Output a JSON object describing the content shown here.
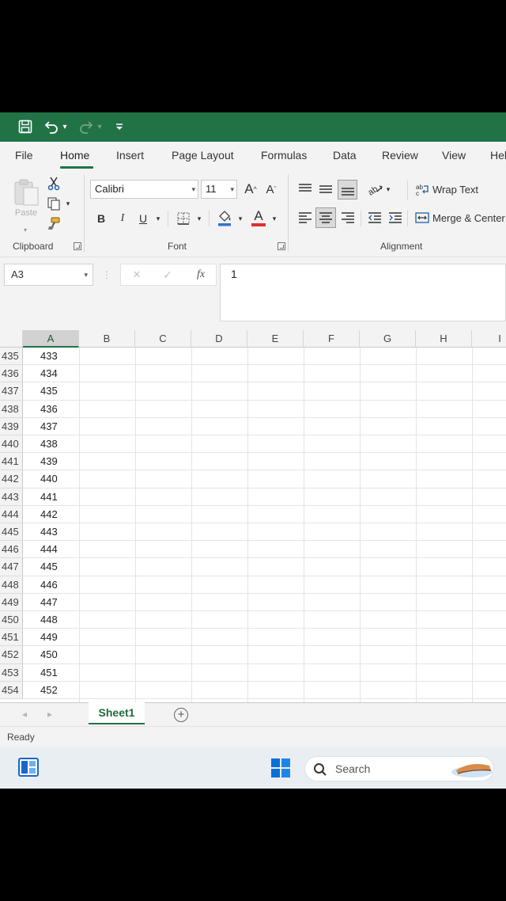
{
  "colors": {
    "excel_green": "#217346",
    "taskbar": "#e9eef3",
    "win_blue": "#0a6fd6"
  },
  "qat": {
    "icons": [
      "save-icon",
      "undo-icon",
      "redo-icon",
      "customize-icon"
    ],
    "dropdown_glyph": "▾"
  },
  "tabs": [
    "File",
    "Home",
    "Insert",
    "Page Layout",
    "Formulas",
    "Data",
    "Review",
    "View",
    "Hel"
  ],
  "ribbon": {
    "clipboard": {
      "label": "Clipboard",
      "paste_label": "Paste"
    },
    "font": {
      "label": "Font",
      "font_name": "Calibri",
      "font_size": "11",
      "bold": "B",
      "italic": "I",
      "underline": "U",
      "increase_font": "A",
      "decrease_font": "A",
      "font_color": "A"
    },
    "alignment": {
      "label": "Alignment",
      "wrap_text": "Wrap Text",
      "merge_center": "Merge & Center"
    }
  },
  "formula_bar": {
    "name_box": "A3",
    "cancel_glyph": "✕",
    "enter_glyph": "✓",
    "fx_glyph": "fx",
    "value": "1"
  },
  "grid": {
    "columns": [
      "A",
      "B",
      "C",
      "D",
      "E",
      "F",
      "G",
      "H",
      "I"
    ],
    "selected_column": "A",
    "rows": [
      {
        "row": "435",
        "a": "433"
      },
      {
        "row": "436",
        "a": "434"
      },
      {
        "row": "437",
        "a": "435"
      },
      {
        "row": "438",
        "a": "436"
      },
      {
        "row": "439",
        "a": "437"
      },
      {
        "row": "440",
        "a": "438"
      },
      {
        "row": "441",
        "a": "439"
      },
      {
        "row": "442",
        "a": "440"
      },
      {
        "row": "443",
        "a": "441"
      },
      {
        "row": "444",
        "a": "442"
      },
      {
        "row": "445",
        "a": "443"
      },
      {
        "row": "446",
        "a": "444"
      },
      {
        "row": "447",
        "a": "445"
      },
      {
        "row": "448",
        "a": "446"
      },
      {
        "row": "449",
        "a": "447"
      },
      {
        "row": "450",
        "a": "448"
      },
      {
        "row": "451",
        "a": "449"
      },
      {
        "row": "452",
        "a": "450"
      },
      {
        "row": "453",
        "a": "451"
      },
      {
        "row": "454",
        "a": "452"
      }
    ]
  },
  "sheets": {
    "active": "Sheet1",
    "add_glyph": "+"
  },
  "status": {
    "text": "Ready"
  },
  "taskbar": {
    "search_label": "Search"
  }
}
